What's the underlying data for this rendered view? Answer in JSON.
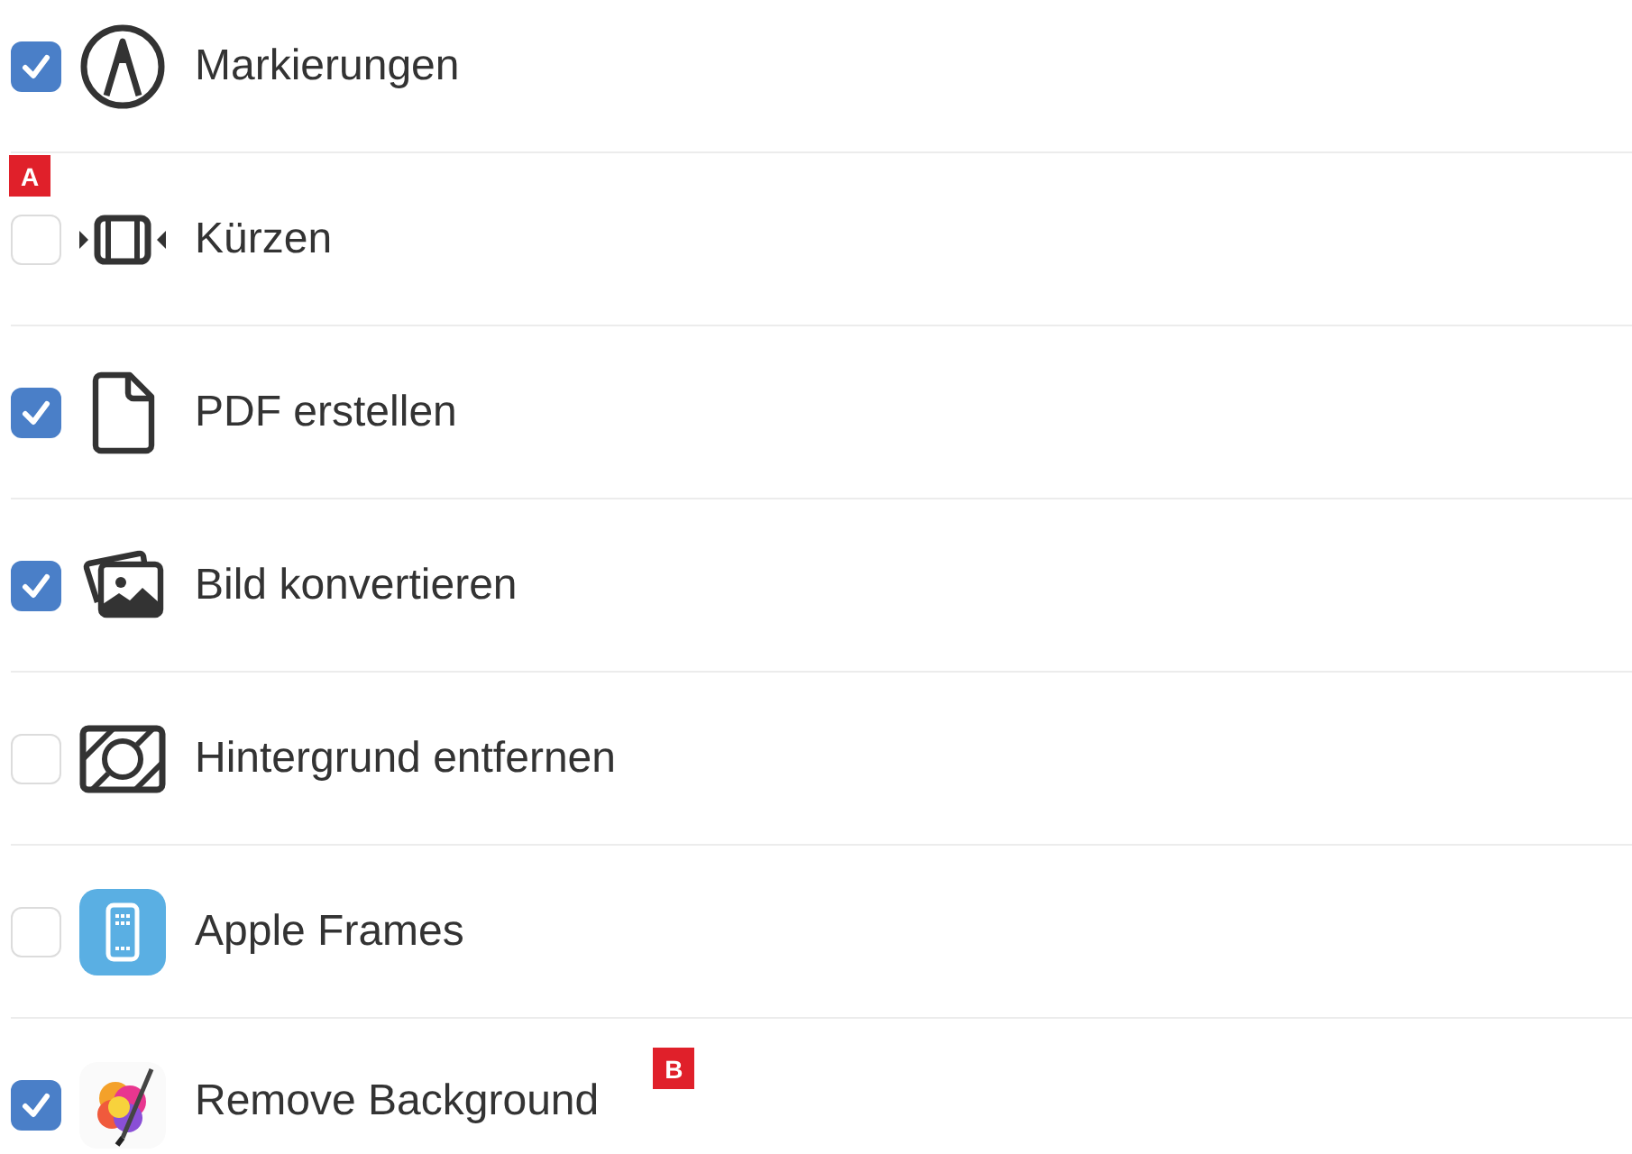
{
  "actions": [
    {
      "label": "Markierungen",
      "checked": true
    },
    {
      "label": "Kürzen",
      "checked": false,
      "badge": {
        "text": "A",
        "kind": "corner"
      }
    },
    {
      "label": "PDF erstellen",
      "checked": true
    },
    {
      "label": "Bild konvertieren",
      "checked": true
    },
    {
      "label": "Hintergrund entfernen",
      "checked": false
    },
    {
      "label": "Apple Frames",
      "checked": false
    },
    {
      "label": "Remove Background",
      "checked": true,
      "badge": {
        "text": "B",
        "kind": "inline"
      }
    }
  ]
}
